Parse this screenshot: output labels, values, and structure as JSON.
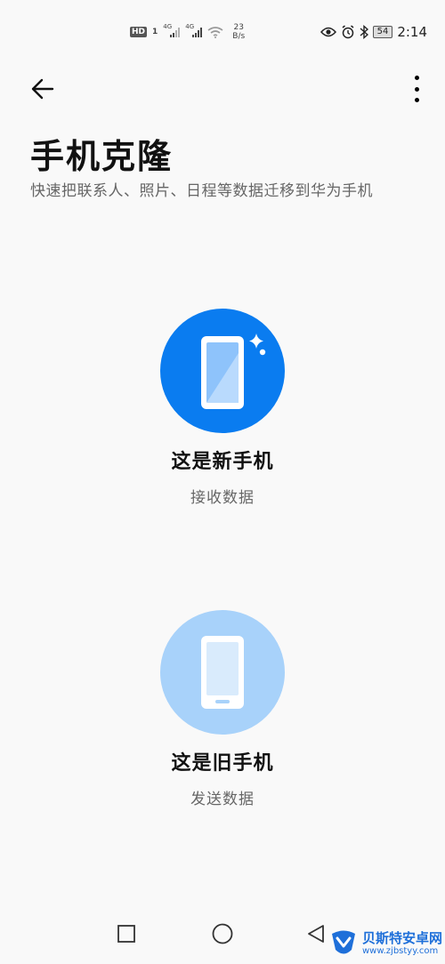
{
  "status_bar": {
    "hd_badge": "HD",
    "sim1": "1",
    "network1": "4G",
    "network2": "4G",
    "speed_value": "23",
    "speed_unit": "B/s",
    "battery": "54",
    "time": "2:14"
  },
  "header": {
    "title": "手机克隆",
    "subtitle": "快速把联系人、照片、日程等数据迁移到华为手机"
  },
  "options": [
    {
      "label": "这是新手机",
      "sub": "接收数据"
    },
    {
      "label": "这是旧手机",
      "sub": "发送数据"
    }
  ],
  "watermark": {
    "title": "贝斯特安卓网",
    "url": "www.zjbstyy.com"
  },
  "colors": {
    "new_phone_circle": "#0a7cf0",
    "old_phone_circle": "#a8d2fa",
    "background": "#f9f9f9"
  },
  "icons": {
    "back": "arrow-left-icon",
    "more": "more-vertical-icon",
    "recent": "square-icon",
    "home": "circle-icon",
    "nav_back": "triangle-back-icon"
  }
}
